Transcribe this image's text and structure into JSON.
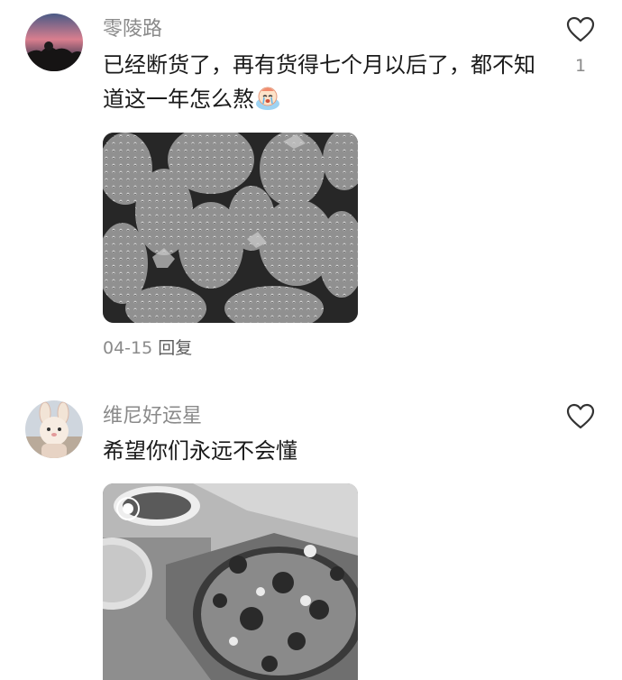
{
  "comments": [
    {
      "username": "零陵路",
      "text": "已经断货了，再有货得七个月以后了，都不知道这一年怎么熬",
      "emoji": "crying-face-emoji",
      "date": "04-15",
      "reply_label": "回复",
      "like_count": "1",
      "like_icon": "heart-outline-icon",
      "image_subject": "strawberries"
    },
    {
      "username": "维尼好运星",
      "text": "希望你们永远不会懂",
      "like_icon": "heart-outline-icon",
      "image_subject": "pizza-and-soup"
    }
  ],
  "colors": {
    "username": "#8a8a8a",
    "text": "#1a1a1a",
    "meta": "#8a8a8a",
    "icon_stroke": "#333333"
  }
}
